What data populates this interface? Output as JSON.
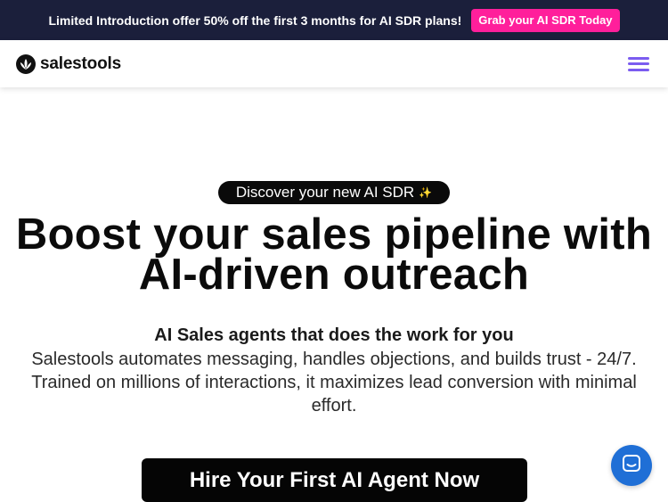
{
  "promo": {
    "text": "Limited Introduction offer 50% off the first 3 months for AI SDR plans!",
    "button_label": "Grab your AI SDR Today"
  },
  "nav": {
    "logo_text": "salestools",
    "menu_icon": "hamburger-icon"
  },
  "hero": {
    "pill_label": "Discover your new AI SDR",
    "pill_icon": "sparkles-icon",
    "headline_line1": "Boost your sales pipeline with",
    "headline_line2": "AI-driven outreach",
    "subhead": "AI Sales agents that does the work for you",
    "description": "Salestools automates messaging, handles objections, and builds trust - 24/7. Trained on millions of interactions, it maximizes lead conversion with minimal effort.",
    "cta_label": "Hire Your First AI Agent Now"
  },
  "chat": {
    "icon": "chat-icon"
  },
  "colors": {
    "promo_bg": "#1b1f3b",
    "promo_button": "#ff1f9b",
    "menu_accent": "#7b5cf0",
    "chat_button": "#1f6fd6"
  }
}
